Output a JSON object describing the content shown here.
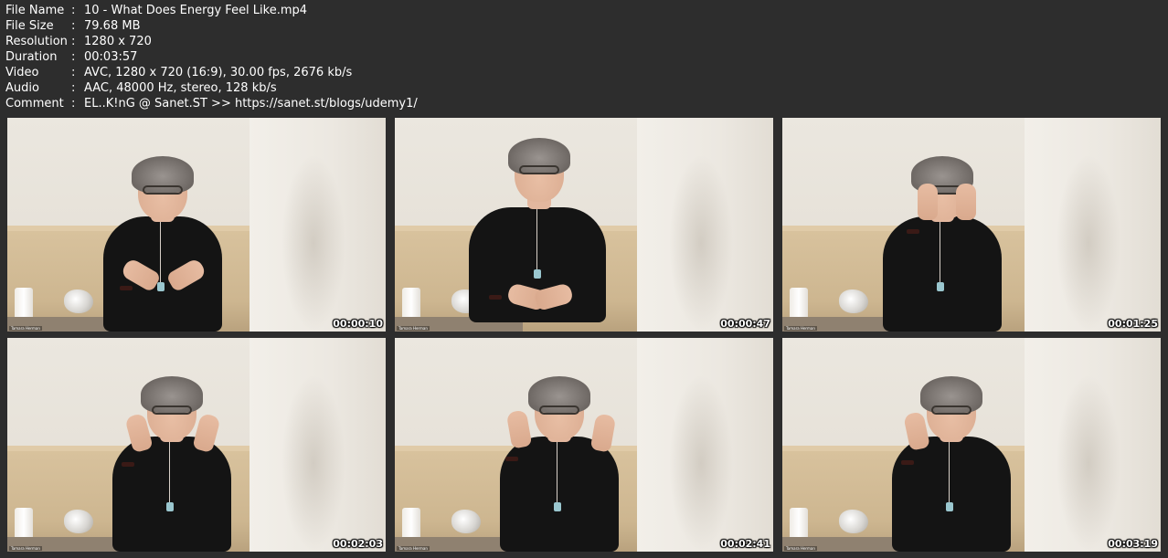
{
  "meta": {
    "file_name_label": "File Name",
    "file_name": "10 - What Does Energy Feel Like.mp4",
    "file_size_label": "File Size",
    "file_size": "79.68 MB",
    "resolution_label": "Resolution",
    "resolution": "1280 x 720",
    "duration_label": "Duration",
    "duration": "00:03:57",
    "video_label": "Video",
    "video": "AVC, 1280 x 720 (16:9), 30.00 fps, 2676 kb/s",
    "audio_label": "Audio",
    "audio": "AAC, 48000 Hz, stereo, 128 kb/s",
    "comment_label": "Comment",
    "comment": "EL..K!nG @ Sanet.ST >> https://sanet.st/blogs/udemy1/",
    "separator": ":"
  },
  "thumbnails": [
    {
      "timestamp": "00:00:10",
      "nametag": "Tamara Herman"
    },
    {
      "timestamp": "00:00:47",
      "nametag": "Tamara Herman"
    },
    {
      "timestamp": "00:01:25",
      "nametag": "Tamara Herman"
    },
    {
      "timestamp": "00:02:03",
      "nametag": "Tamara Herman"
    },
    {
      "timestamp": "00:02:41",
      "nametag": "Tamara Herman"
    },
    {
      "timestamp": "00:03:19",
      "nametag": "Tamara Herman"
    }
  ],
  "colors": {
    "background": "#2d2d2d",
    "text": "#ffffff"
  }
}
